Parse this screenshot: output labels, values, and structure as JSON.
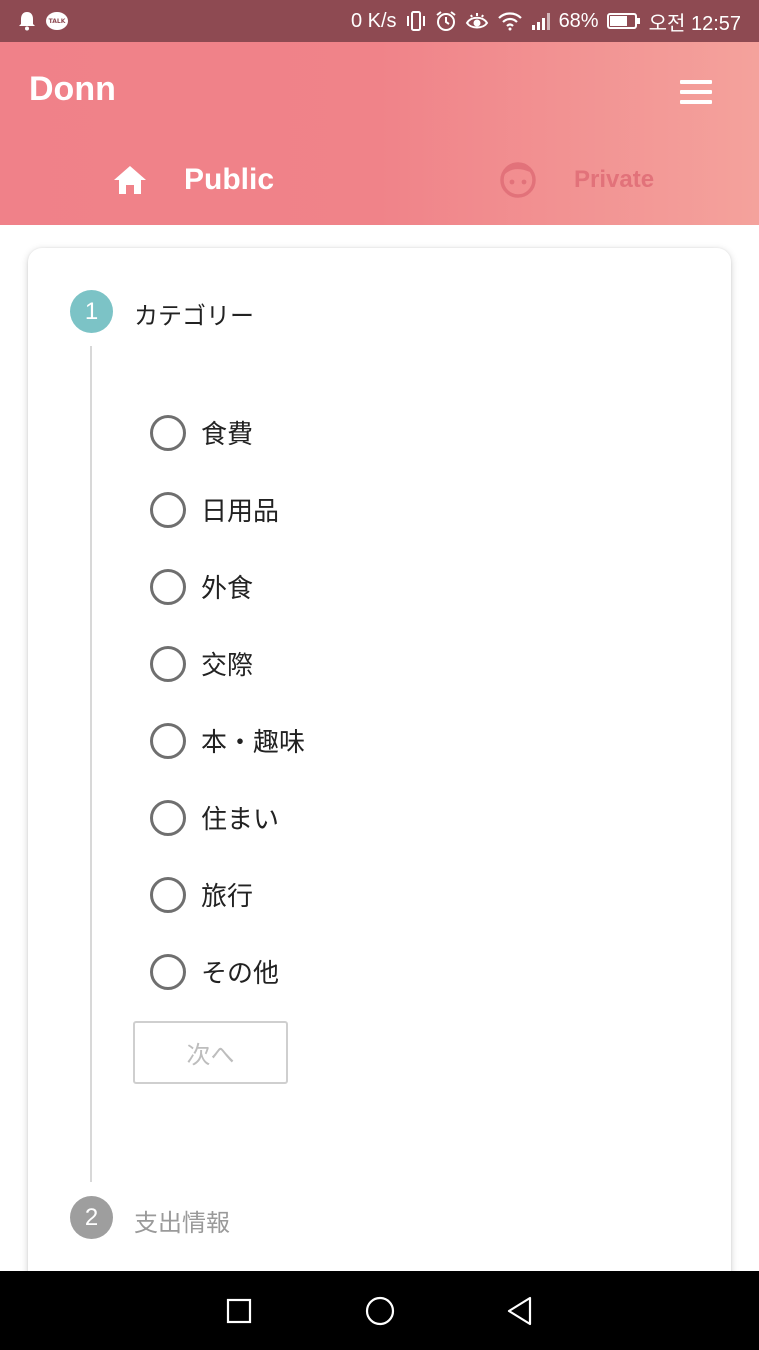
{
  "status_bar": {
    "net_speed": "0 K/s",
    "battery": "68%",
    "time": "오전 12:57",
    "talk_badge": "TALK",
    "icons": [
      "notification-bell-icon",
      "kakaotalk-icon",
      "vibrate-icon",
      "alarm-icon",
      "eye-comfort-icon",
      "wifi-icon",
      "signal-icon",
      "battery-icon"
    ]
  },
  "header": {
    "app_title": "Donn",
    "tabs": [
      {
        "label": "Public",
        "icon": "home-icon",
        "active": true
      },
      {
        "label": "Private",
        "icon": "face-icon",
        "active": false
      }
    ]
  },
  "stepper": {
    "step1": {
      "number": "1",
      "title": "カテゴリー",
      "options": [
        "食費",
        "日用品",
        "外食",
        "交際",
        "本・趣味",
        "住まい",
        "旅行",
        "その他"
      ],
      "next_label": "次へ"
    },
    "step2": {
      "number": "2",
      "title": "支出情報"
    }
  },
  "colors": {
    "status_bar": "#8e4a52",
    "header_start": "#f08189",
    "header_end": "#f4a29c",
    "step_active": "#7cc3c6",
    "step_inactive": "#9e9e9e"
  }
}
